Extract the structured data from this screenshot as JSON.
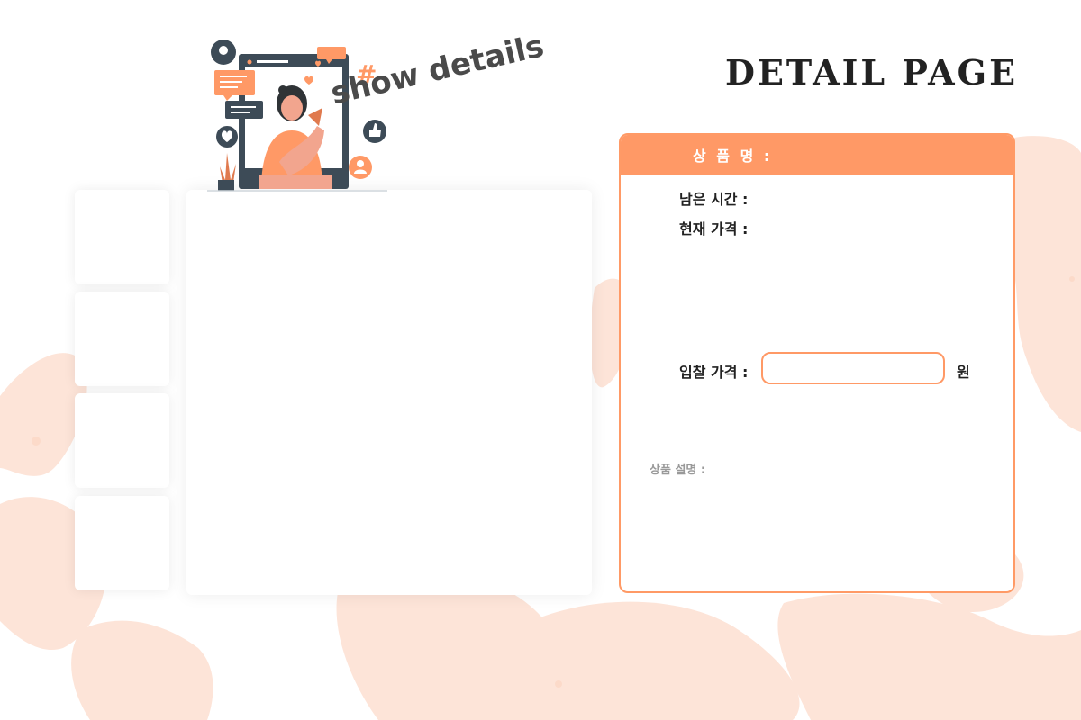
{
  "header": {
    "title": "DETAIL PAGE",
    "hero_caption": "show details"
  },
  "gallery": {
    "thumbnails": [
      "",
      "",
      "",
      ""
    ]
  },
  "detail": {
    "product_name_label": "상 품 명 :",
    "remaining_time_label": "남은 시간  :",
    "current_price_label": "현재 가격  :",
    "bid_price_label": "입찰 가격 :",
    "bid_input_value": "",
    "currency_unit": "원",
    "description_label": "상품 설명  :"
  },
  "colors": {
    "accent": "#ff9966",
    "map_tint": "#fde3d6",
    "dark_text": "#222222"
  }
}
